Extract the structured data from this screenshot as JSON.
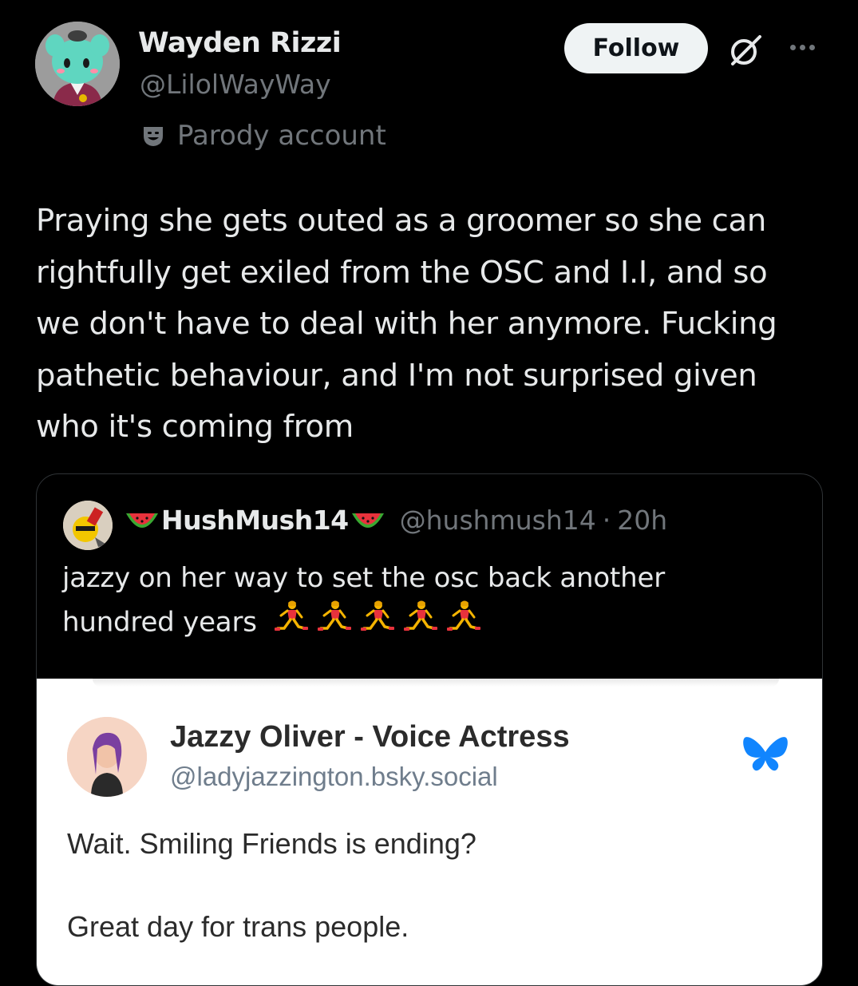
{
  "post": {
    "author": {
      "display_name": "Wayden Rizzi",
      "handle": "@LilolWayWay",
      "label": "Parody account"
    },
    "follow_label": "Follow",
    "text": "Praying she gets outed as a groomer so she can\nrightfully get exiled from the OSC and I.I, and so\nwe don't have to deal with her anymore. Fucking\npathetic behaviour, and I'm not surprised given\nwho it's coming from"
  },
  "quote": {
    "display_name": "HushMush14",
    "handle": "@hushmush14",
    "separator": "·",
    "time": "20h",
    "text_line1": "jazzy on her way to set the osc back another",
    "text_line2": "hundred years",
    "emoji": "watermelon",
    "runner_emoji": "woman-running",
    "runner_count": 5,
    "embed": {
      "display_name": "Jazzy Oliver - Voice Actress",
      "handle": "@ladyjazzington.bsky.social",
      "line1": "Wait. Smiling Friends is ending?",
      "line2": "Great day for trans people.",
      "platform_icon": "bluesky-butterfly-icon"
    }
  },
  "colors": {
    "background": "#000000",
    "text": "#e7e9ea",
    "muted": "#71767b",
    "follow_bg": "#eff3f4",
    "bluesky": "#1185fe"
  }
}
